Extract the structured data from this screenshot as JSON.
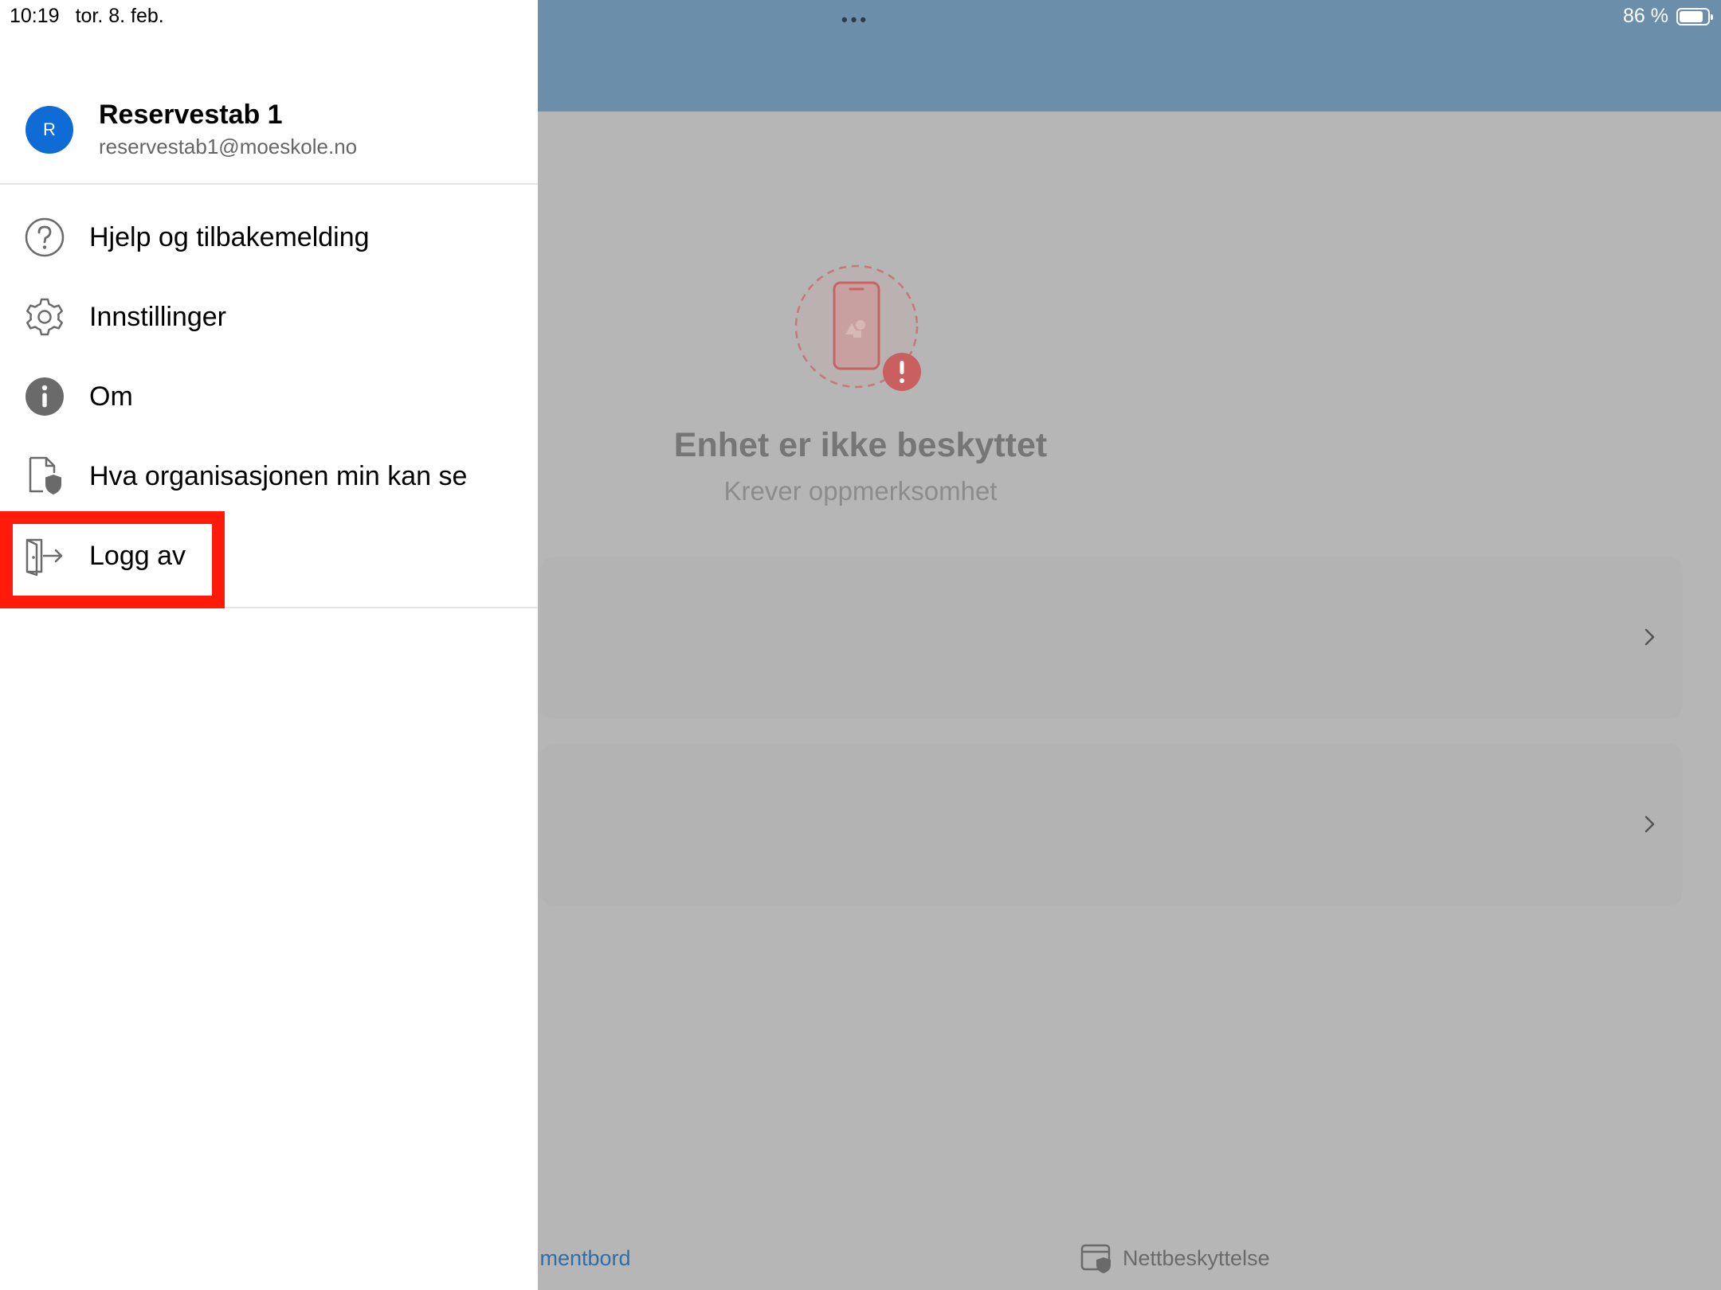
{
  "status_bar": {
    "time": "10:19",
    "date": "tor. 8. feb.",
    "battery_percent": "86 %",
    "battery_level": 0.86,
    "multitask_dots": "•••"
  },
  "drawer": {
    "user": {
      "avatar_initial": "R",
      "name": "Reservestab 1",
      "email": "reservestab1@moeskole.no"
    },
    "menu": [
      {
        "label": "Hjelp og tilbakemelding",
        "icon": "help-circle-icon"
      },
      {
        "label": "Innstillinger",
        "icon": "gear-icon"
      },
      {
        "label": "Om",
        "icon": "info-icon"
      },
      {
        "label": "Hva organisasjonen min kan se",
        "icon": "document-shield-icon"
      },
      {
        "label": "Logg av",
        "icon": "sign-out-icon",
        "highlighted": true
      }
    ]
  },
  "main": {
    "status_title": "Enhet er ikke beskyttet",
    "status_subtitle": "Krever oppmerksomhet"
  },
  "tabbar": {
    "dashboard_partial": "ımentbord",
    "web_protection": "Nettbeskyttelse"
  },
  "colors": {
    "header": "#6b8eab",
    "accent": "#0f6cd6",
    "highlight_box": "#ff1a0a",
    "warning": "#c95f5f"
  }
}
